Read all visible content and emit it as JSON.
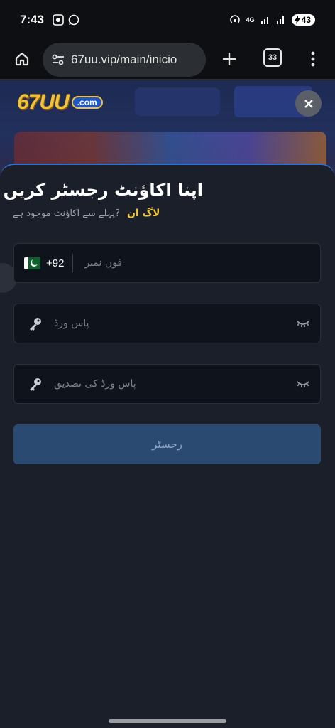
{
  "status_bar": {
    "time": "7:43",
    "network": "4G",
    "battery": "43"
  },
  "browser": {
    "url": "67uu.vip/main/inicio",
    "tab_count": "33"
  },
  "site": {
    "logo_text": "67UU",
    "logo_suffix": ".com"
  },
  "register": {
    "title": "اپنا اکاؤنٹ رجسٹر کریں",
    "subtitle": "?پہلے سے اکاؤنٹ موجود ہے",
    "login_link": "لاگ ان",
    "phone_code": "+92",
    "phone_placeholder": "فون نمبر",
    "password_placeholder": "پاس ورڈ",
    "confirm_placeholder": "پاس ورڈ کی تصدیق",
    "submit_label": "رجسٹر"
  },
  "colors": {
    "accent": "#f0c43c",
    "sheet_border": "#2d6fd0",
    "button_bg": "#2a4a72"
  }
}
